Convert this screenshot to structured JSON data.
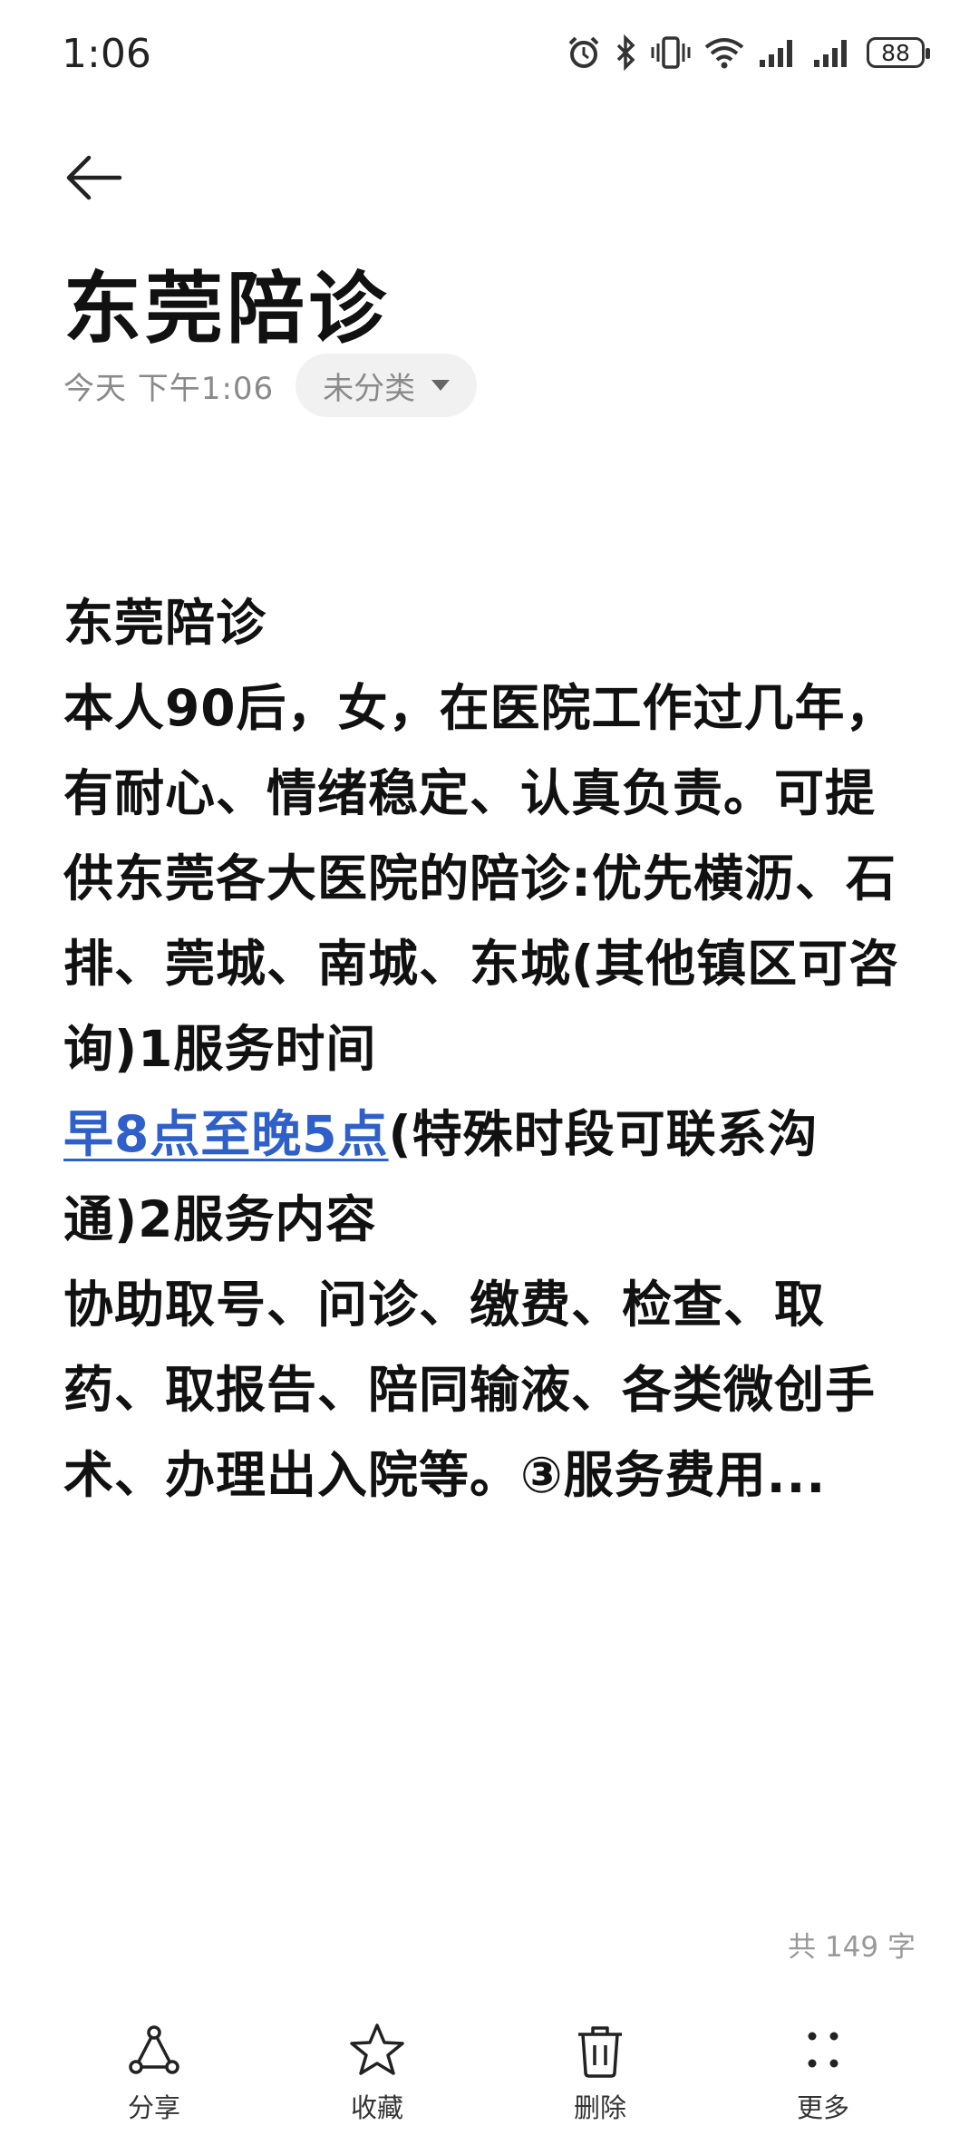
{
  "status_bar": {
    "time": "1:06",
    "battery": "88"
  },
  "note": {
    "title": "东莞陪诊",
    "date": "今天 下午1:06",
    "category": "未分类",
    "content": {
      "line_title": "东莞陪诊",
      "para1": "本人90后，女，在医院工作过几年，有耐心、情绪稳定、认真负责。可提供东莞各大医院的陪诊:优先横沥、石排、莞城、南城、东城(其他镇区可咨询)1服务时间",
      "link_text": "早8点至晚5点",
      "para2": "(特殊时段可联系沟通)2服务内容",
      "para3": "协助取号、问诊、缴费、检查、取药、取报告、陪同输液、各类微创手术、办理出入院等。③服务费用..."
    },
    "word_count": "共 149 字"
  },
  "toolbar": {
    "share": "分享",
    "favorite": "收藏",
    "delete": "删除",
    "more": "更多"
  },
  "colors": {
    "link": "#2f5fc9",
    "muted": "#8a8a8a"
  }
}
